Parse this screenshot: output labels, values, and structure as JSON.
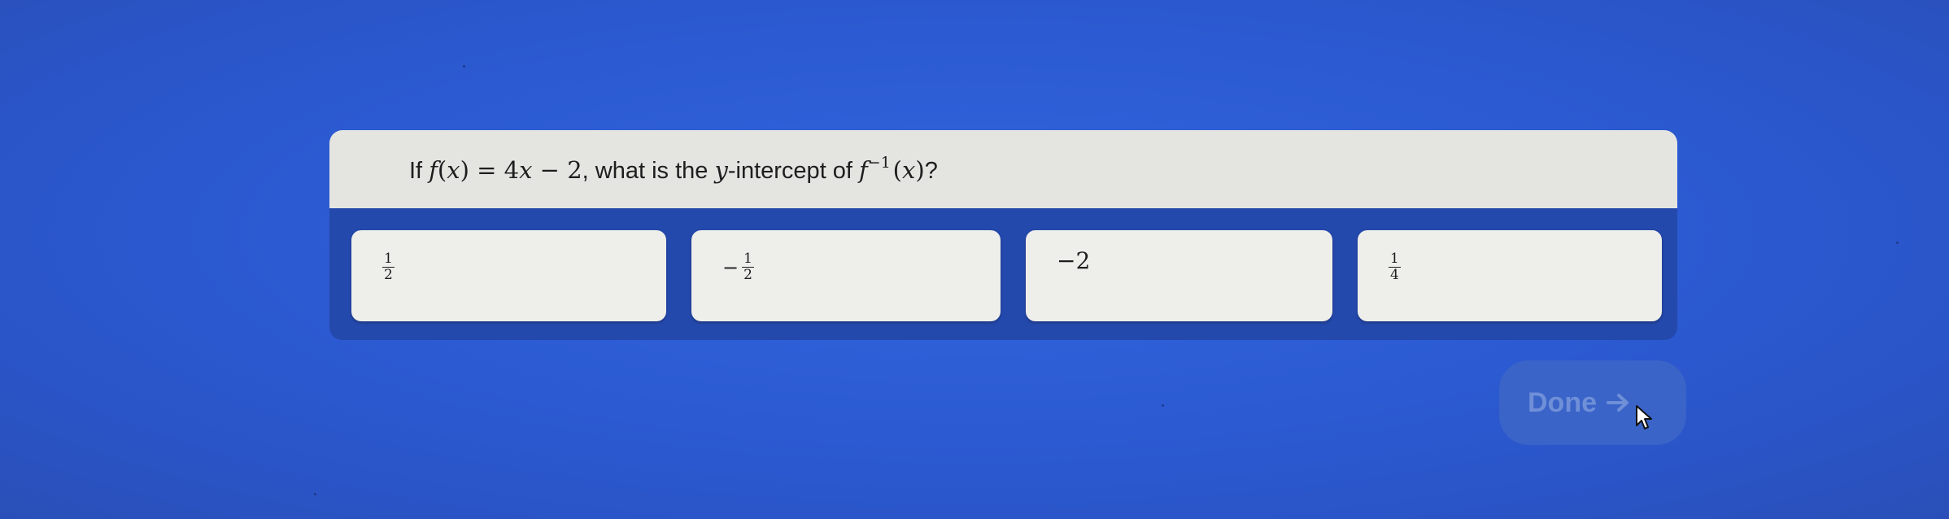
{
  "question": {
    "prefix": "If ",
    "f_label": "f",
    "x_var": "x",
    "equals_expr": " = 4",
    "minus_expr": " − 2",
    "middle_text": ", what is the ",
    "y_var": "y",
    "intercept_text": "-intercept of ",
    "inverse_label": "f",
    "inverse_sup": "−1",
    "suffix": "?"
  },
  "options": [
    {
      "sign": "",
      "numerator": "1",
      "denominator": "2"
    },
    {
      "sign": "−",
      "numerator": "1",
      "denominator": "2"
    },
    {
      "value": "−2"
    },
    {
      "sign": "",
      "numerator": "1",
      "denominator": "4"
    }
  ],
  "done_button": {
    "label": "Done",
    "icon": "arrow-right-icon",
    "state": "disabled"
  },
  "colors": {
    "background": "#2c5bd4",
    "card_frame": "#2449ac",
    "question_bar": "#e4e5e1",
    "option_card": "#eeeeeb",
    "done_bg": "#3a64c8",
    "done_text": "#6f8fd8"
  }
}
